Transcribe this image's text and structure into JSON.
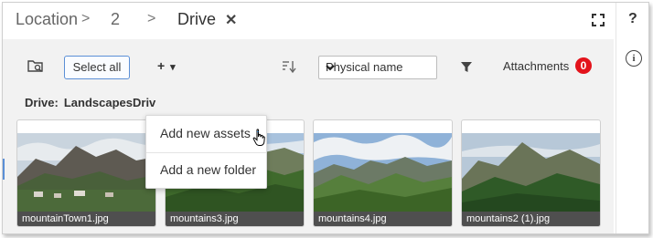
{
  "header": {
    "breadcrumbs": [
      "Location",
      "2",
      "Drive"
    ],
    "separators": [
      ">",
      ">"
    ],
    "close_glyph": "✕",
    "icons": [
      "expand-icon",
      "help-icon"
    ],
    "help_glyph": "?"
  },
  "right_rail": {
    "info_glyph": "i",
    "icon": "info-icon"
  },
  "toolbar": {
    "folder_search_icon": "folder-search-icon",
    "select_all_label": "Select all",
    "add_glyph": "+",
    "add_caret": "▾",
    "sort_icon": "sort-icon",
    "sort_value": "Physical name",
    "filter_icon": "filter-icon",
    "attachments_label": "Attachments",
    "attachments_count": "0",
    "badge_color": "#e3131b"
  },
  "drive": {
    "label": "Drive:",
    "value": "LandscapesDriv"
  },
  "add_menu": {
    "items": [
      "Add new assets",
      "Add a new folder"
    ]
  },
  "assets": [
    {
      "name": "mountainTown1.jpg"
    },
    {
      "name": "mountains3.jpg"
    },
    {
      "name": "mountains4.jpg"
    },
    {
      "name": "mountains2 (1).jpg"
    }
  ],
  "colors": {
    "accent": "#5b8fd6",
    "background": "#f2f2f2"
  }
}
